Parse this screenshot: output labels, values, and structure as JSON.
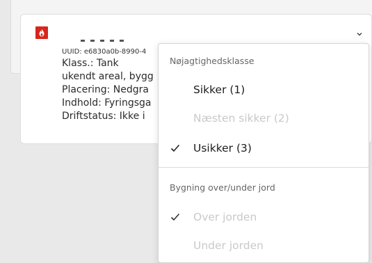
{
  "card": {
    "uuid": "UUID: e6830a0b-8990-4",
    "lines": [
      "Klass.: Tank",
      "ukendt areal, bygg",
      "Placering: Nedgra",
      "Indhold: Fyringsga",
      "Driftstatus: Ikke i"
    ],
    "icon": "flame-icon",
    "expand_icon": "chevron-down-icon"
  },
  "dropdown": {
    "accuracy_section": {
      "header": "Nøjagtighedsklasse",
      "options": [
        {
          "label": "Sikker (1)",
          "state": "enabled",
          "checked": false
        },
        {
          "label": "Næsten sikker (2)",
          "state": "disabled",
          "checked": false
        },
        {
          "label": "Usikker (3)",
          "state": "enabled",
          "checked": true
        }
      ]
    },
    "building_section": {
      "header": "Bygning over/under jord",
      "options": [
        {
          "label": "Over jorden",
          "state": "disabled",
          "checked": true
        },
        {
          "label": "Under jorden",
          "state": "disabled",
          "checked": false
        }
      ]
    }
  },
  "colors": {
    "accent_red": "#d7261c",
    "disabled_text": "#c9c9c9",
    "page_bg": "#e9e9e9"
  }
}
